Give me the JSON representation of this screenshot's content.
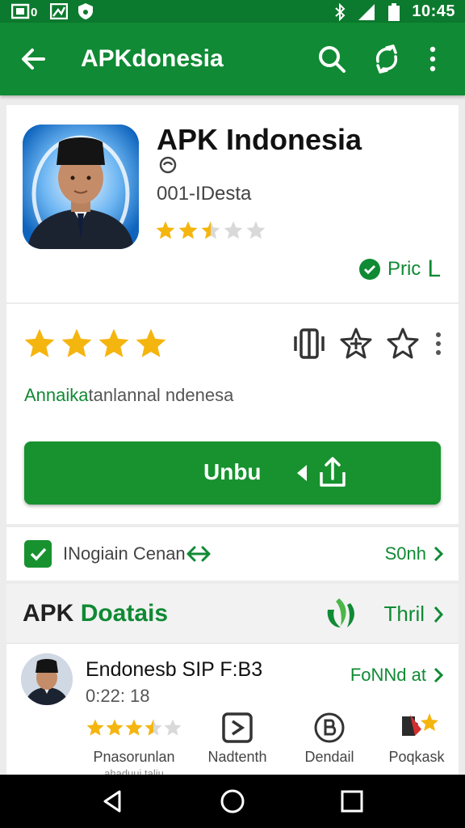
{
  "status_bar": {
    "time": "10:45",
    "left_glyph": "0"
  },
  "app_bar": {
    "title": "APKdonesia",
    "icons": [
      "back-arrow-icon",
      "search-icon",
      "share-icon",
      "overflow-menu-icon"
    ]
  },
  "app": {
    "name": "APK Indonesia",
    "developer": "001-IDesta",
    "small_rating": 2.5,
    "price_label": "Pric",
    "price_bracket": "L"
  },
  "rating_card": {
    "stars": 4,
    "tagline_highlight": "Annaika",
    "tagline_rest": "tanlannal ndenesa",
    "primary_button": "Unbu"
  },
  "install_row": {
    "label": "INogiain Cenan",
    "see_more": "S0nh"
  },
  "details": {
    "title_dark": "APK",
    "title_green": "Doatais",
    "link": "Thril",
    "item": {
      "title": "Endonesb SIP F:B3",
      "time": "0:22: 18",
      "link": "FoNNd at",
      "rating": 3.5
    },
    "features": [
      {
        "label": "Pnasorunlan",
        "sub": "ahaduui taliu",
        "icon": "stars-rating-icon"
      },
      {
        "label": "Nadtenth",
        "icon": "play-box-icon"
      },
      {
        "label": "Dendail",
        "icon": "badge-b-icon"
      },
      {
        "label": "Poqkask",
        "icon": "puzzle-star-icon"
      }
    ]
  },
  "colors": {
    "primary": "#108a34",
    "status_bar": "#0c7a2e",
    "star": "#f5b50f",
    "button": "#17922f"
  }
}
